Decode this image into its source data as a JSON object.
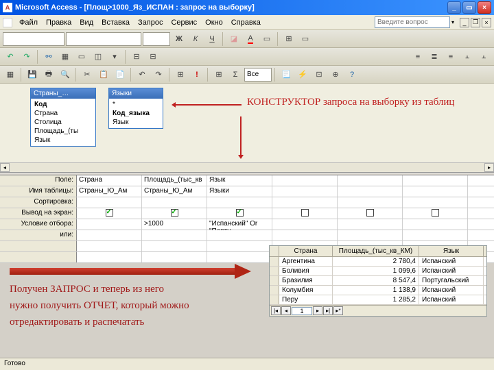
{
  "titlebar": {
    "app_icon_text": "A",
    "title": "Microsoft Access - [Площ>1000_Яз_ИСПАН : запрос на выборку]"
  },
  "menu": {
    "items": [
      "Файл",
      "Правка",
      "Вид",
      "Вставка",
      "Запрос",
      "Сервис",
      "Окно",
      "Справка"
    ],
    "help_placeholder": "Введите вопрос"
  },
  "toolbar3": {
    "combo_label": "Все"
  },
  "design": {
    "table1": {
      "title": "Страны_…",
      "fields": [
        "Код",
        "Страна",
        "Столица",
        "Площадь_(ты",
        "Язык"
      ],
      "bold_index": 0
    },
    "table2": {
      "title": "Языки",
      "fields": [
        "*",
        "Код_языка",
        "Язык"
      ],
      "bold_index": 1
    }
  },
  "annotation": {
    "constructor": "КОНСТРУКТОР  запроса на выборку из  таблиц"
  },
  "qbe": {
    "labels": {
      "field": "Поле:",
      "table": "Имя таблицы:",
      "sort": "Сортировка:",
      "show": "Вывод на экран:",
      "criteria": "Условие отбора:",
      "or": "или:"
    },
    "cols": [
      {
        "field": "Страна",
        "table": "Страны_Ю_Ам",
        "show": true,
        "criteria": ""
      },
      {
        "field": "Площадь_(тыс_кв",
        "table": "Страны_Ю_Ам",
        "show": true,
        "criteria": ">1000"
      },
      {
        "field": "Язык",
        "table": "Языки",
        "show": true,
        "criteria": "\"Испанский\" Or \"Порту"
      },
      {
        "field": "",
        "table": "",
        "show": false,
        "criteria": ""
      },
      {
        "field": "",
        "table": "",
        "show": false,
        "criteria": ""
      },
      {
        "field": "",
        "table": "",
        "show": false,
        "criteria": ""
      }
    ]
  },
  "lower": {
    "line1": "Получен ЗАПРОС и теперь из него",
    "line2": "нужно получить ОТЧЕТ,  который  можно",
    "line3": "отредактировать и  распечатать"
  },
  "result": {
    "headers": [
      "Страна",
      "Площадь_(тыс_кв_КМ)",
      "Язык"
    ],
    "rows": [
      [
        "Аргентина",
        "2 780,4",
        "Испанский"
      ],
      [
        "Боливия",
        "1 099,6",
        "Испанский"
      ],
      [
        "Бразилия",
        "8 547,4",
        "Португальский"
      ],
      [
        "Колумбия",
        "1 138,9",
        "Испанский"
      ],
      [
        "Перу",
        "1 285,2",
        "Испанский"
      ]
    ],
    "nav_record": "1"
  },
  "statusbar": {
    "text": "Готово"
  }
}
